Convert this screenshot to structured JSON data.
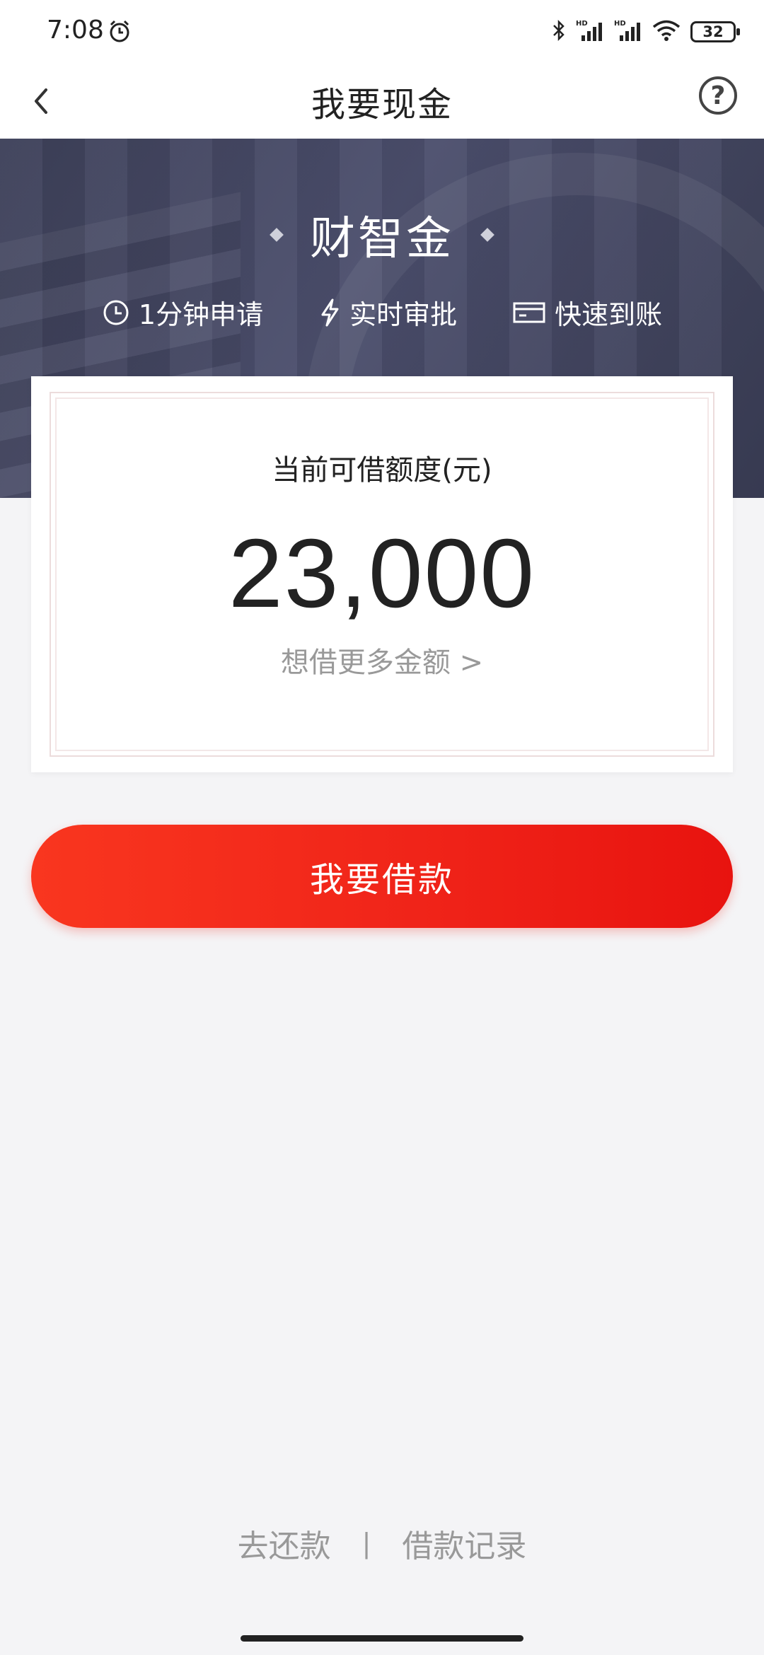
{
  "status_bar": {
    "time": "7:08",
    "battery": "32",
    "icons": [
      "alarm-icon",
      "bluetooth-icon",
      "signal-hd-icon",
      "signal-hd-icon",
      "wifi-icon",
      "battery-icon"
    ]
  },
  "nav": {
    "title": "我要现金",
    "back_icon": "chevron-left-icon",
    "help_label": "?"
  },
  "hero": {
    "brand": "财智金",
    "features": [
      {
        "icon": "clock-icon",
        "label": "1分钟申请"
      },
      {
        "icon": "lightning-icon",
        "label": "实时审批"
      },
      {
        "icon": "card-icon",
        "label": "快速到账"
      }
    ]
  },
  "credit": {
    "label": "当前可借额度(元)",
    "amount": "23,000",
    "more_link": "想借更多金额 >"
  },
  "actions": {
    "borrow_label": "我要借款"
  },
  "footer": {
    "repay_label": "去还款",
    "divider": "|",
    "records_label": "借款记录"
  },
  "colors": {
    "accent_red": "#f02419",
    "hero_bg": "#454863",
    "page_bg": "#f4f4f6"
  }
}
